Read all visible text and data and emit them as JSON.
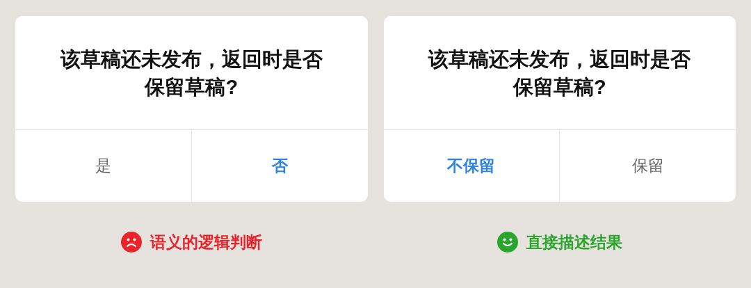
{
  "panels": [
    {
      "dialog": {
        "message": "该草稿还未发布，返回时是否保留草稿?",
        "buttons": [
          {
            "label": "是",
            "emphasized": false
          },
          {
            "label": "否",
            "emphasized": true
          }
        ]
      },
      "verdict": {
        "kind": "sad",
        "text": "语义的逻辑判断",
        "color": "#e8232a"
      }
    },
    {
      "dialog": {
        "message": "该草稿还未发布，返回时是否保留草稿?",
        "buttons": [
          {
            "label": "不保留",
            "emphasized": true
          },
          {
            "label": "保留",
            "emphasized": false
          }
        ]
      },
      "verdict": {
        "kind": "happy",
        "text": "直接描述结果",
        "color": "#2aa52c"
      }
    }
  ]
}
